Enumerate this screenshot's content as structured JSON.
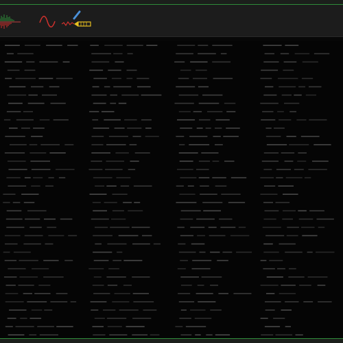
{
  "toolbar": {
    "buttons": [
      {
        "icon": "audio-waveform-icon"
      },
      {
        "icon": "sine-wave-icon"
      },
      {
        "icon": "synth-pen-icon"
      }
    ]
  },
  "colors": {
    "accent_green": "#2e8b3a",
    "text_dim": "#3c3c3c",
    "icon_red": "#d0312d",
    "icon_yellow": "#e8c020",
    "icon_blue": "#4a90d9"
  },
  "content": {
    "columns": 4,
    "rows": 36
  }
}
